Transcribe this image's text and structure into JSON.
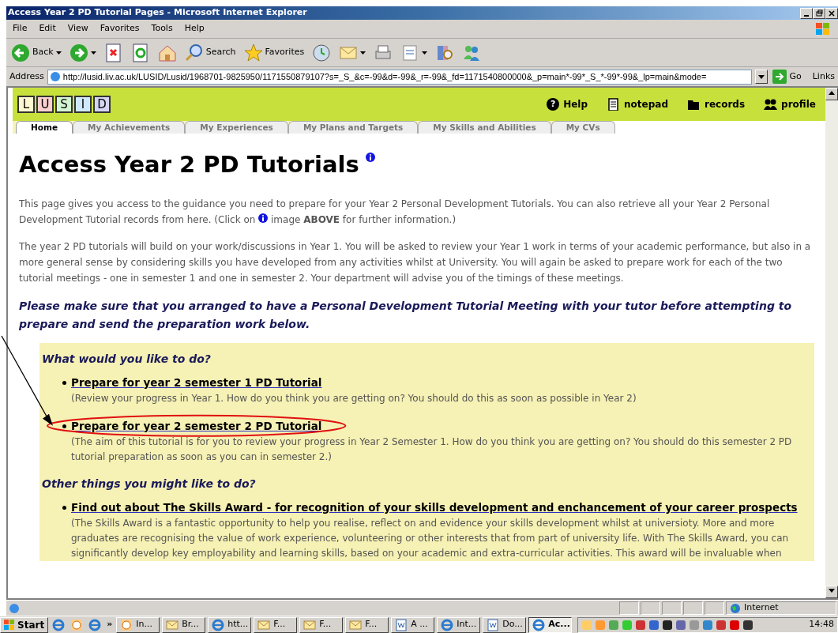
{
  "window": {
    "title": "Access Year 2 PD Tutorial Pages - Microsoft Internet Explorer"
  },
  "menu": [
    "File",
    "Edit",
    "View",
    "Favorites",
    "Tools",
    "Help"
  ],
  "toolbar": [
    {
      "kind": "back",
      "label": "Back"
    },
    {
      "kind": "forward"
    },
    {
      "kind": "stop"
    },
    {
      "kind": "refresh"
    },
    {
      "kind": "home"
    },
    {
      "kind": "search",
      "label": "Search"
    },
    {
      "kind": "favorites",
      "label": "Favorites"
    },
    {
      "kind": "history"
    },
    {
      "kind": "mail"
    },
    {
      "kind": "print"
    },
    {
      "kind": "edit"
    },
    {
      "kind": "research"
    },
    {
      "kind": "messenger"
    }
  ],
  "address": {
    "label": "Address",
    "value": "http://lusid.liv.ac.uk/LUSID/Lusid/1968701-9825950/1171550879107?s=_S_&c=-99&d=-99&_r=-99&_fd=1171540800000&_p=main*-99*_S_*-99*-99&_lp=main&mode=",
    "go": "Go",
    "links": "Links"
  },
  "site": {
    "logo": [
      {
        "letter": "L",
        "color": "#fdf8cf"
      },
      {
        "letter": "U",
        "color": "#fbd0d0"
      },
      {
        "letter": "S",
        "color": "#d3f5d3"
      },
      {
        "letter": "I",
        "color": "#cfe8fb"
      },
      {
        "letter": "D",
        "color": "#d5d5f5"
      }
    ],
    "links": [
      {
        "kind": "help",
        "label": "Help",
        "icon": "?"
      },
      {
        "kind": "notepad",
        "label": "notepad"
      },
      {
        "kind": "records",
        "label": "records"
      },
      {
        "kind": "profile",
        "label": "profile"
      }
    ],
    "tabs": [
      {
        "label": "Home",
        "selected": true
      },
      {
        "label": "My Achievements",
        "selected": false
      },
      {
        "label": "My Experiences",
        "selected": false
      },
      {
        "label": "My Plans and Targets",
        "selected": false
      },
      {
        "label": "My Skills and Abilities",
        "selected": false
      },
      {
        "label": "My CVs",
        "selected": false
      }
    ]
  },
  "page": {
    "heading": "Access Year 2 PD Tutorials",
    "intro_before": "This page gives you access to the guidance you need to prepare for your Year 2 Personal Development Tutorials. You can also retrieve all your Year 2 Personal Development Tutorial records from here. (Click on",
    "intro_after": "image **ABOVE** for further information.)",
    "paragraph": "The year 2 PD tutorials will build on your work/discussions in Year 1. You will be asked to review your Year 1 work in terms of your academic performance, but also in a more general sense by considering skills you have developed from any activities whilst at University. You will again be asked to prepare work for each of the two tutorial meetings - one in semester 1 and one in semester 2. Your department will advise you of the timings of these meetings.",
    "notice": "Please make sure that you arranged to have a Personal Development Tutorial Meeting with your tutor before attempting to prepare and send the preparation work below.",
    "sections": [
      {
        "heading": "What would you like to do?",
        "items": [
          {
            "link": "Prepare for year 2 semester 1 PD Tutorial",
            "description": "(Review your progress in Year 1. How do you think you are getting on? You should do this as soon as possible in Year 2)",
            "circled": false
          },
          {
            "link": "Prepare for year 2 semester 2 PD Tutorial",
            "description": "(The aim of this tutorial is for you to review your progress in Year 2 Semester 1. How do you think you are getting on? You should do this semester 2 PD tutorial preparation as soon as you can in semester 2.)",
            "circled": true
          }
        ]
      },
      {
        "heading": "Other things you might like to do?",
        "items": [
          {
            "link": "Find out about The Skills Award - for recognition of your skills development and enchancement of your career prospects",
            "description": "(The Skills Award is a fantastic opportunity to help you realise, reflect on and evidence your skills development whilst at universioty. More and more graduates are recognising the value of work experience, volunteering or other interests that from part of university life. With The Skills Award, you can significantly develop key employability and learning skills, based on your academic and extra-curricular activities. This award will be invaluable when",
            "circled": false
          }
        ]
      }
    ]
  },
  "status_bar": {
    "zone": "Internet"
  },
  "taskbar": {
    "start": "Start",
    "more": "»",
    "items": [
      {
        "kind": "clock",
        "label": "In...",
        "active": false
      },
      {
        "kind": "mail",
        "label": "Br...",
        "active": false
      },
      {
        "kind": "ie",
        "label": "htt...",
        "active": false
      },
      {
        "kind": "mail",
        "label": "F...",
        "active": false
      },
      {
        "kind": "mail",
        "label": "F...",
        "active": false
      },
      {
        "kind": "mail",
        "label": "F...",
        "active": false
      },
      {
        "kind": "word",
        "label": "A ...",
        "active": false
      },
      {
        "kind": "ie",
        "label": "Int...",
        "active": false
      },
      {
        "kind": "word",
        "label": "Do...",
        "active": false
      },
      {
        "kind": "ie",
        "label": "Ac...",
        "active": true
      }
    ],
    "time": "14:48"
  }
}
